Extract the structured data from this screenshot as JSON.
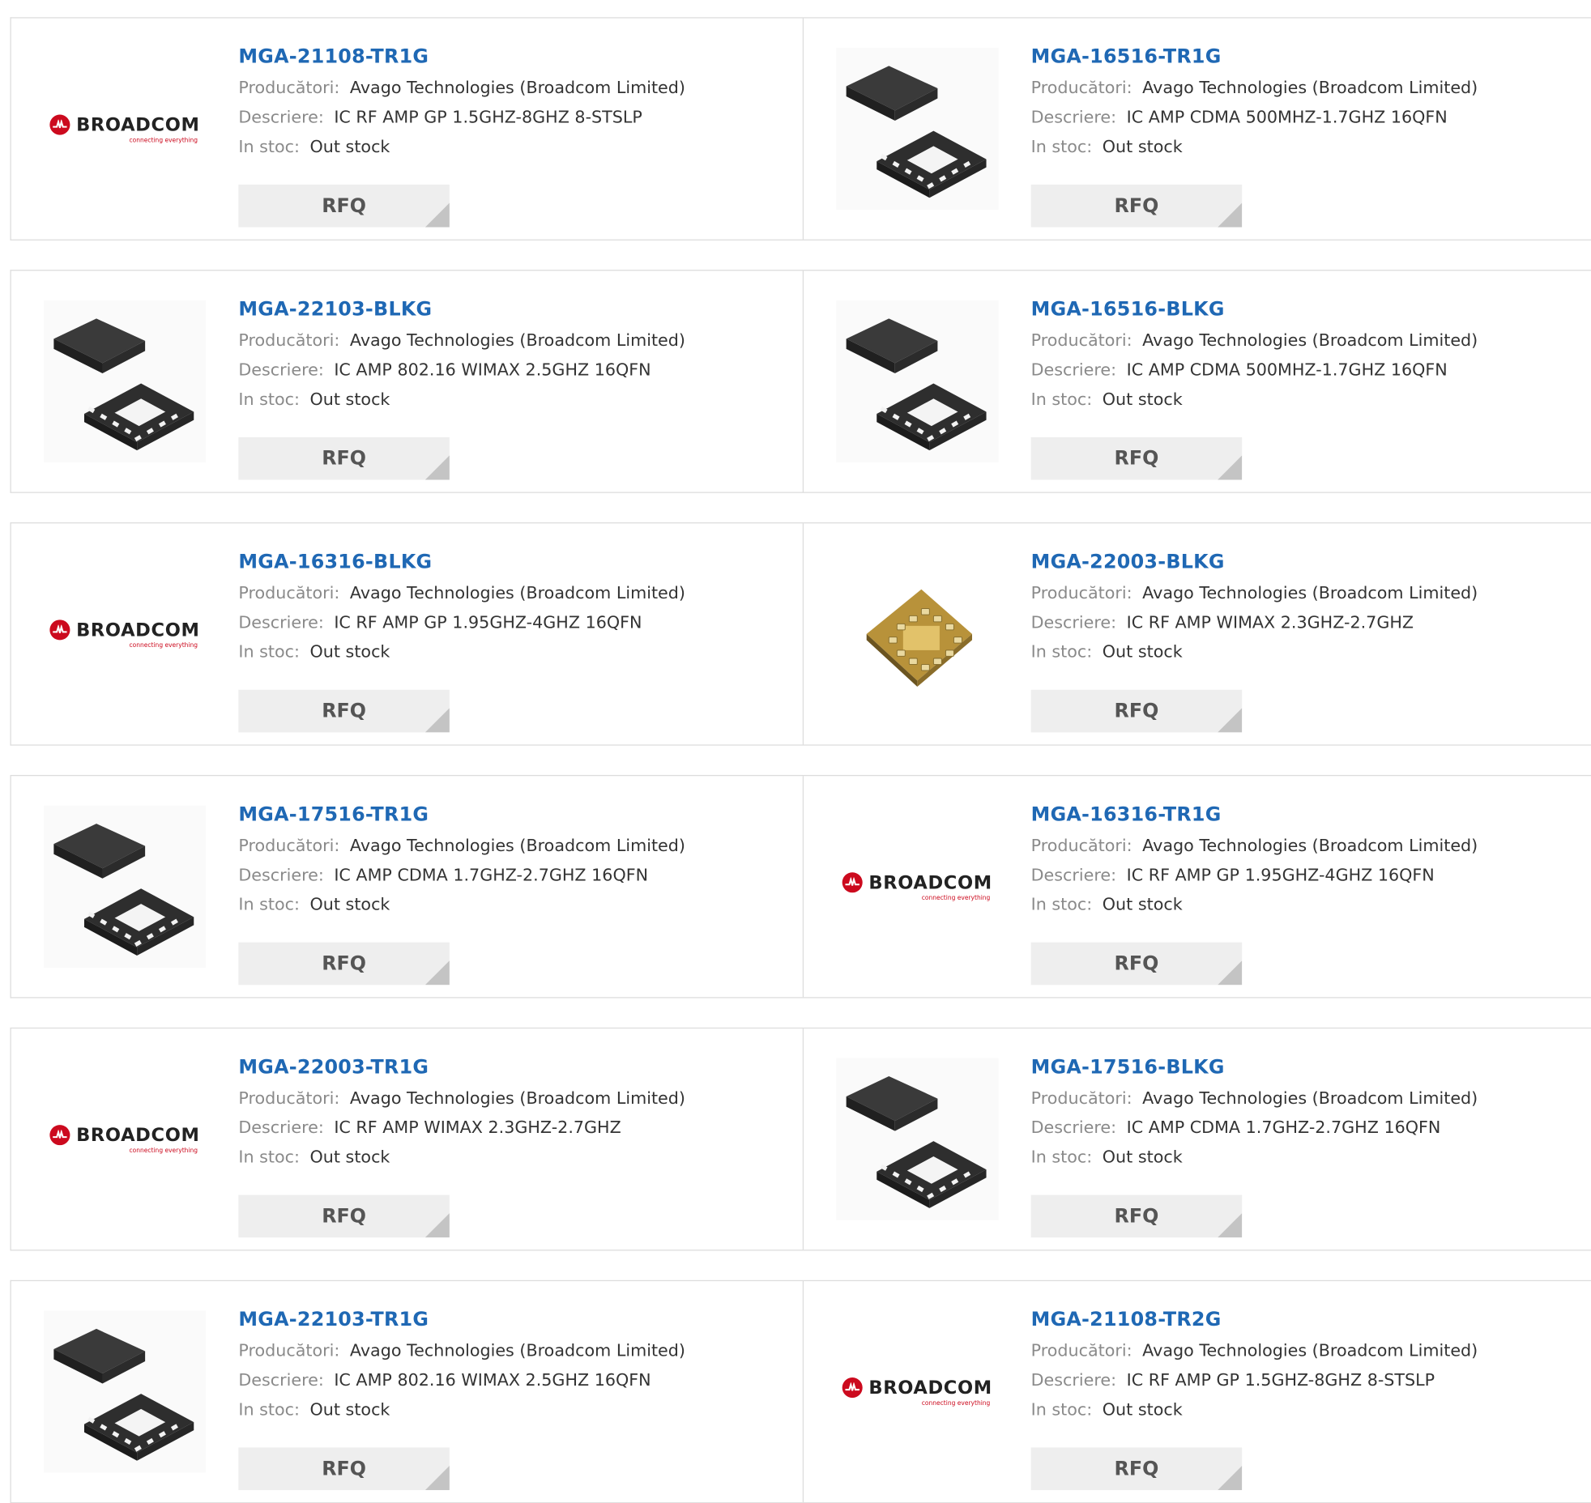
{
  "labels": {
    "manufacturer": "Producători:",
    "description": "Descriere:",
    "stock": "In stoc:"
  },
  "rfq_label": "RFQ",
  "brand": {
    "name": "BROADCOM",
    "tagline": "connecting everything"
  },
  "colors": {
    "title": "#1f68b4",
    "brand_red": "#cc0a1e",
    "button_bg": "#eeeeee"
  },
  "rows": [
    {
      "left": {
        "part": "MGA-21108-TR1G",
        "manufacturer": "Avago Technologies (Broadcom Limited)",
        "description": "IC RF AMP GP 1.5GHZ-8GHZ 8-STSLP",
        "stock": "Out stock",
        "image": "broadcom-logo"
      },
      "right": {
        "part": "MGA-16516-TR1G",
        "manufacturer": "Avago Technologies (Broadcom Limited)",
        "description": "IC AMP CDMA 500MHZ-1.7GHZ 16QFN",
        "stock": "Out stock",
        "image": "qfn-chip"
      }
    },
    {
      "left": {
        "part": "MGA-22103-BLKG",
        "manufacturer": "Avago Technologies (Broadcom Limited)",
        "description": "IC AMP 802.16 WIMAX 2.5GHZ 16QFN",
        "stock": "Out stock",
        "image": "qfn-chip"
      },
      "right": {
        "part": "MGA-16516-BLKG",
        "manufacturer": "Avago Technologies (Broadcom Limited)",
        "description": "IC AMP CDMA 500MHZ-1.7GHZ 16QFN",
        "stock": "Out stock",
        "image": "qfn-chip"
      }
    },
    {
      "left": {
        "part": "MGA-16316-BLKG",
        "manufacturer": "Avago Technologies (Broadcom Limited)",
        "description": "IC RF AMP GP 1.95GHZ-4GHZ 16QFN",
        "stock": "Out stock",
        "image": "broadcom-logo"
      },
      "right": {
        "part": "MGA-22003-BLKG",
        "manufacturer": "Avago Technologies (Broadcom Limited)",
        "description": "IC RF AMP WIMAX 2.3GHZ-2.7GHZ",
        "stock": "Out stock",
        "image": "gold-chip"
      }
    },
    {
      "left": {
        "part": "MGA-17516-TR1G",
        "manufacturer": "Avago Technologies (Broadcom Limited)",
        "description": "IC AMP CDMA 1.7GHZ-2.7GHZ 16QFN",
        "stock": "Out stock",
        "image": "qfn-chip"
      },
      "right": {
        "part": "MGA-16316-TR1G",
        "manufacturer": "Avago Technologies (Broadcom Limited)",
        "description": "IC RF AMP GP 1.95GHZ-4GHZ 16QFN",
        "stock": "Out stock",
        "image": "broadcom-logo"
      }
    },
    {
      "left": {
        "part": "MGA-22003-TR1G",
        "manufacturer": "Avago Technologies (Broadcom Limited)",
        "description": "IC RF AMP WIMAX 2.3GHZ-2.7GHZ",
        "stock": "Out stock",
        "image": "broadcom-logo"
      },
      "right": {
        "part": "MGA-17516-BLKG",
        "manufacturer": "Avago Technologies (Broadcom Limited)",
        "description": "IC AMP CDMA 1.7GHZ-2.7GHZ 16QFN",
        "stock": "Out stock",
        "image": "qfn-chip"
      }
    },
    {
      "left": {
        "part": "MGA-22103-TR1G",
        "manufacturer": "Avago Technologies (Broadcom Limited)",
        "description": "IC AMP 802.16 WIMAX 2.5GHZ 16QFN",
        "stock": "Out stock",
        "image": "qfn-chip"
      },
      "right": {
        "part": "MGA-21108-TR2G",
        "manufacturer": "Avago Technologies (Broadcom Limited)",
        "description": "IC RF AMP GP 1.5GHZ-8GHZ 8-STSLP",
        "stock": "Out stock",
        "image": "broadcom-logo"
      }
    }
  ]
}
